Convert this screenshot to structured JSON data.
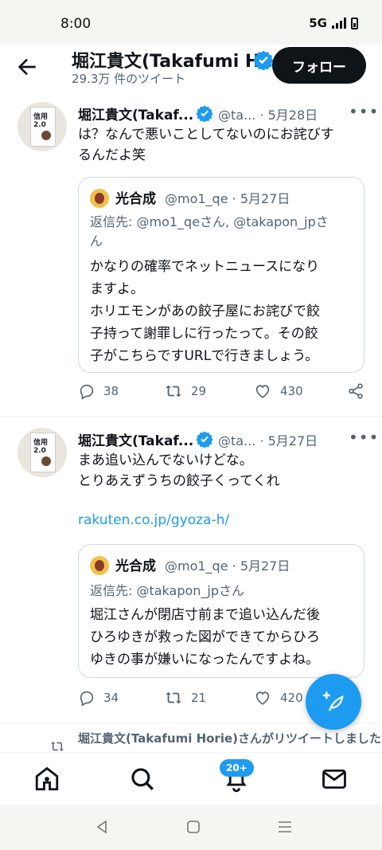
{
  "status_bar": {
    "time": "8:00",
    "network": "5G"
  },
  "header": {
    "title": "堀江貴文(Takafumi H...",
    "subtitle": "29.3万 件のツイート",
    "follow_label": "フォロー"
  },
  "tweets": [
    {
      "author": "堀江貴文(Takaf...",
      "handle_date": "@ta... · 5月28日",
      "text_lines": [
        "は？なんで悪いことしてないのにお詫びす",
        "るんだよ笑"
      ],
      "quote": {
        "author": "光合成",
        "handle_date": "@mo1_qe · 5月27日",
        "reply_lines": [
          "返信先: @mo1_qeさん, @takapon_jpさ",
          "ん"
        ],
        "text_lines": [
          "かなりの確率でネットニュースになり",
          "ますよ。",
          "ホリエモンがあの餃子屋にお詫びで餃",
          "子持って謝罪しに行ったって。その餃",
          "子がこちらですURLで行きましょう。"
        ]
      },
      "replies": "38",
      "retweets": "29",
      "likes": "430"
    },
    {
      "author": "堀江貴文(Takaf...",
      "handle_date": "@ta... · 5月27日",
      "text_lines": [
        "まあ追い込んでないけどな。",
        "とりあえずうちの餃子くってくれ"
      ],
      "link": "rakuten.co.jp/gyoza-h/",
      "quote": {
        "author": "光合成",
        "handle_date": "@mo1_qe · 5月27日",
        "reply_lines": [
          "返信先: @takapon_jpさん"
        ],
        "text_lines": [
          "堀江さんが閉店寸前まで追い込んだ後",
          "ひろゆきが救った図ができてからひろ",
          "ゆきの事が嫌いになったんですよね。"
        ]
      },
      "replies": "34",
      "retweets": "21",
      "likes": "420"
    }
  ],
  "retweet_notice": "堀江貴文(Takafumi Horie)さんがリツイートしました",
  "avatar_book_text": "信用\n2.0",
  "nav": {
    "notifications_badge": "20+"
  },
  "colors": {
    "accent": "#1d9bf0",
    "text": "#0f1419",
    "muted": "#536471"
  }
}
